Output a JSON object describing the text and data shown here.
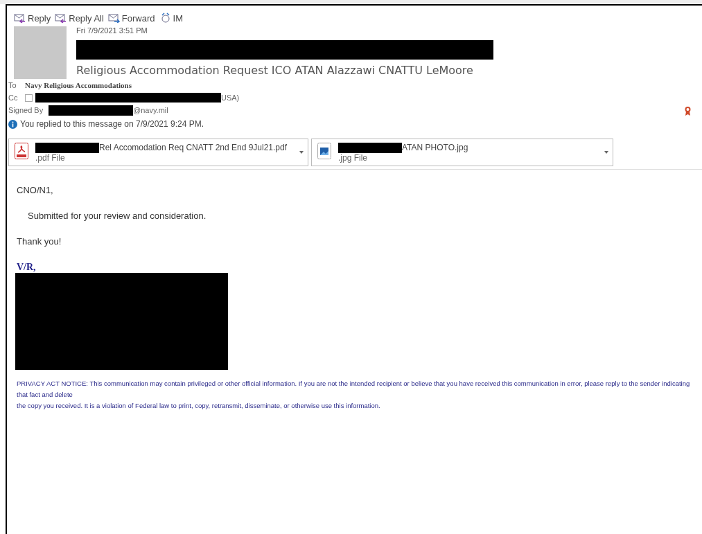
{
  "actions": [
    {
      "label": "Reply",
      "kind": "reply"
    },
    {
      "label": "Reply All",
      "kind": "reply-all"
    },
    {
      "label": "Forward",
      "kind": "forward"
    },
    {
      "label": "IM",
      "kind": "im"
    }
  ],
  "header": {
    "date": "Fri 7/9/2021 3:51 PM",
    "subject": "Religious Accommodation Request ICO ATAN Alazzawi CNATTU LeMoore",
    "to_label": "To",
    "to": "Navy Religious Accommodations",
    "cc_label": "Cc",
    "cc_checked": false,
    "cc_tail": "USA)",
    "signed_label": "Signed By",
    "signed_tail": "@navy.mil",
    "info": "You replied to this message on 7/9/2021 9:24 PM."
  },
  "attachments": [
    {
      "kind": "pdf",
      "name": "Rel Accomodation Req CNATT 2nd End 9Jul21.pdf",
      "type": ".pdf File"
    },
    {
      "kind": "image",
      "name": "ATAN PHOTO.jpg",
      "type": ".jpg File"
    }
  ],
  "body": {
    "greeting": "CNO/N1,",
    "paragraphs": [
      "Submitted for your review and consideration.",
      "Thank you!"
    ],
    "signoff": "V/R,",
    "notice": [
      "PRIVACY ACT NOTICE: This communication may contain privileged or other official information. If you are not the intended recipient or believe that you have received this communication in error, please reply to the sender indicating that fact and delete",
      "the copy you received. It is a violation of Federal law to print, copy, retransmit, disseminate, or otherwise use this information."
    ]
  }
}
